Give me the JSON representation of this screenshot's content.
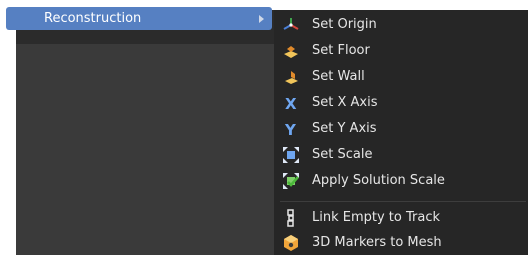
{
  "parent_menu": {
    "item_label": "Reconstruction"
  },
  "submenu": {
    "items": [
      {
        "label": "Set Origin",
        "icon": "set-origin-icon"
      },
      {
        "label": "Set Floor",
        "icon": "set-floor-icon"
      },
      {
        "label": "Set Wall",
        "icon": "set-wall-icon"
      },
      {
        "label": "Set X Axis",
        "icon": "x-axis-icon"
      },
      {
        "label": "Set Y Axis",
        "icon": "y-axis-icon"
      },
      {
        "label": "Set Scale",
        "icon": "set-scale-icon"
      },
      {
        "label": "Apply Solution Scale",
        "icon": "apply-solution-scale-icon"
      },
      {
        "label": "Link Empty to Track",
        "icon": "link-empty-icon"
      },
      {
        "label": "3D Markers to Mesh",
        "icon": "markers-to-mesh-icon"
      }
    ]
  },
  "colors": {
    "highlight": "#5680c2",
    "menu_bg": "#262626",
    "text": "#e6e6e6"
  }
}
